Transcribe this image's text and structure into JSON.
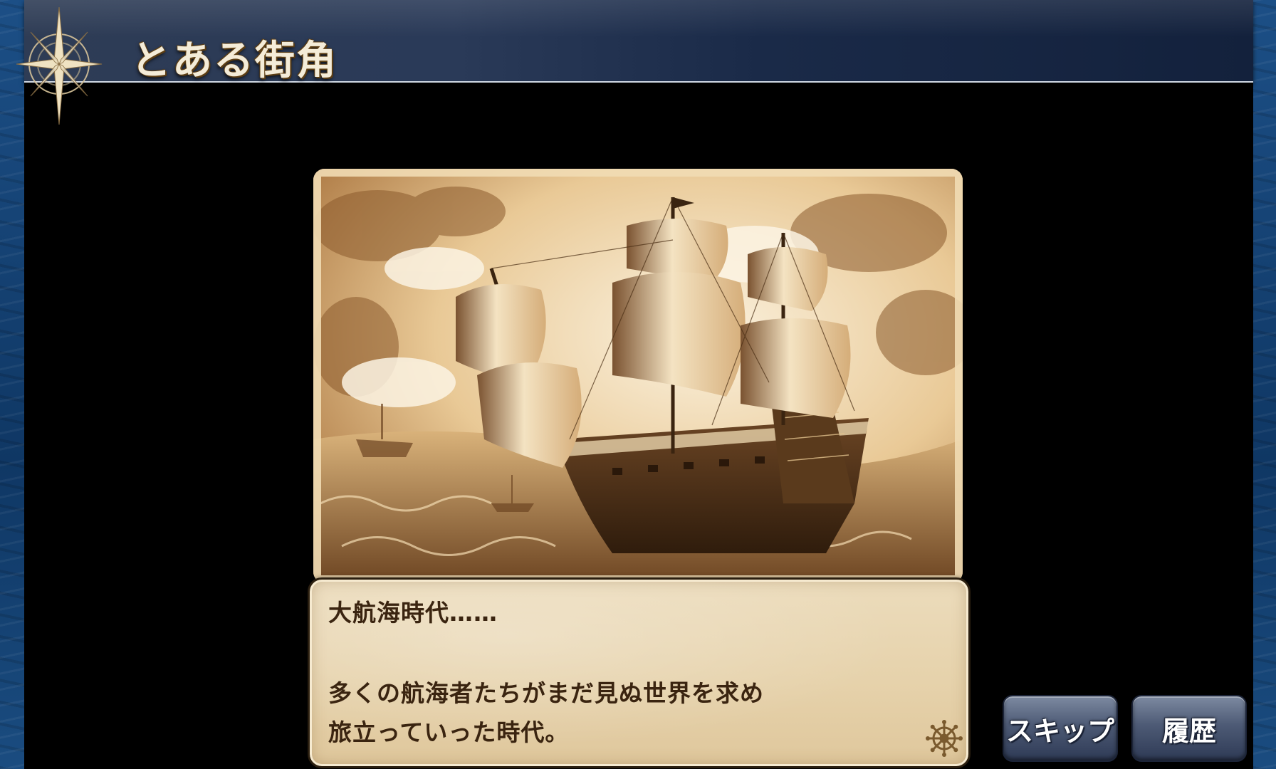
{
  "header": {
    "location_title": "とある街角"
  },
  "scene": {
    "subject": "sepia illustration of a galleon sailing on rough seas"
  },
  "dialog": {
    "lines": [
      "大航海時代……",
      "多くの航海者たちがまだ見ぬ世界を求め",
      "旅立っていった時代。"
    ],
    "advance_icon": "ship-wheel-icon"
  },
  "buttons": {
    "skip_label": "スキップ",
    "history_label": "履歴"
  },
  "colors": {
    "title_bar": "#2a3a58",
    "sepia": "#c89a5c",
    "dialog_paper": "#e6d2ab",
    "button": "#4d5a75",
    "ocean": "#123a66"
  }
}
